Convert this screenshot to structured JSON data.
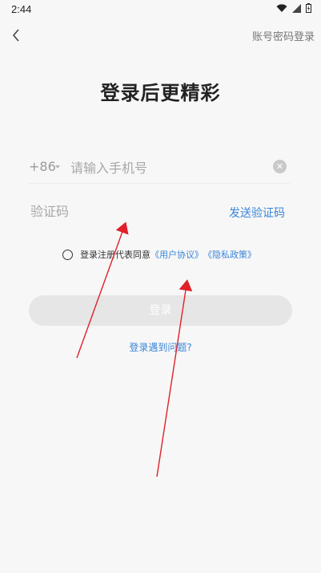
{
  "status": {
    "time": "2:44"
  },
  "header": {
    "password_login": "账号密码登录"
  },
  "main": {
    "title": "登录后更精彩",
    "country_code": "+86",
    "phone_placeholder": "请输入手机号",
    "code_placeholder": "验证码",
    "send_code": "发送验证码",
    "agree_prefix": "登录注册代表同意",
    "user_agreement": "《用户协议》",
    "privacy_policy": "《隐私政策》",
    "login_button": "登录",
    "help_link": "登录遇到问题?"
  },
  "colors": {
    "accent": "#3a86d8",
    "annotation": "#e0202a",
    "button_disabled": "#e6e6e6"
  }
}
